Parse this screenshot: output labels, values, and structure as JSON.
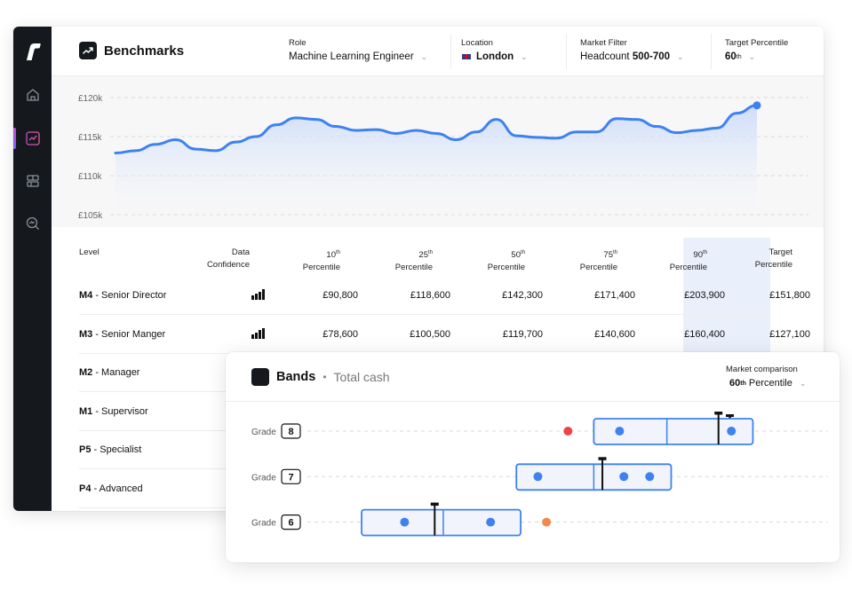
{
  "sidebar": {
    "logo": "r",
    "items": [
      {
        "icon": "home-icon"
      },
      {
        "icon": "trend-icon",
        "active": true
      },
      {
        "icon": "layout-icon"
      },
      {
        "icon": "search-chart-icon"
      }
    ]
  },
  "header": {
    "title": "Benchmarks",
    "filters": [
      {
        "label": "Role",
        "value": "Machine Learning Engineer"
      },
      {
        "label": "Location",
        "value": "London"
      },
      {
        "label": "Market Filter",
        "prefix": "Headcount",
        "value": "500-700"
      },
      {
        "label": "Target Percentile",
        "value": "60",
        "suffix": "th"
      }
    ]
  },
  "chart_data": {
    "type": "area",
    "yticks": [
      "£120k",
      "£115k",
      "£110k",
      "£105k"
    ],
    "ylim": [
      105,
      120
    ],
    "values": [
      112.9,
      113.2,
      114.0,
      114.6,
      113.4,
      113.2,
      114.3,
      115.0,
      116.5,
      117.4,
      117.2,
      116.3,
      115.8,
      115.9,
      115.4,
      115.8,
      115.4,
      114.6,
      115.6,
      117.2,
      115.1,
      114.9,
      114.8,
      115.6,
      115.6,
      117.3,
      117.2,
      116.3,
      115.5,
      115.8,
      116.1,
      118.0,
      119.0
    ],
    "grid": true,
    "line_color": "#3d82f0"
  },
  "table": {
    "headers": {
      "level": "Level",
      "confidence": [
        "Data",
        "Confidence"
      ],
      "p10": [
        "10",
        "th",
        "Percentile"
      ],
      "p25": [
        "25",
        "th",
        "Percentile"
      ],
      "p50": [
        "50",
        "th",
        "Percentile"
      ],
      "p75": [
        "75",
        "th",
        "Percentile"
      ],
      "p90": [
        "90",
        "th",
        "Percentile"
      ],
      "target": [
        "Target",
        "Percentile"
      ]
    },
    "rows": [
      {
        "code": "M4",
        "name": " - Senior Director",
        "p10": "£90,800",
        "p25": "£118,600",
        "p50": "£142,300",
        "p75": "£171,400",
        "p90": "£203,900",
        "target": "£151,800",
        "confidence": 4
      },
      {
        "code": "M3",
        "name": " - Senior Manger",
        "p10": "£78,600",
        "p25": "£100,500",
        "p50": "£119,700",
        "p75": "£140,600",
        "p90": "£160,400",
        "target": "£127,100",
        "confidence": 4
      },
      {
        "code": "M2",
        "name": " - Manager"
      },
      {
        "code": "M1",
        "name": " - Supervisor"
      },
      {
        "code": "P5",
        "name": " - Specialist"
      },
      {
        "code": "P4",
        "name": " - Advanced"
      }
    ]
  },
  "bands": {
    "title": "Bands",
    "subtitle": "Total cash",
    "comparison_label": "Market comparison",
    "comparison_value": "60",
    "comparison_suffix": "th",
    "comparison_word": " Percentile",
    "grade_label": "Grade",
    "grades": [
      {
        "grade": "8",
        "band_start": 0.54,
        "band_end": 0.91,
        "midpoint": 0.71,
        "marker": 0.83,
        "dots": [
          0.6,
          0.86
        ],
        "outlier": 0.48,
        "outlier_color": "#ef4444"
      },
      {
        "grade": "7",
        "band_start": 0.36,
        "band_end": 0.72,
        "midpoint": 0.54,
        "marker": 0.56,
        "dots": [
          0.41,
          0.61,
          0.67
        ],
        "outlier": null
      },
      {
        "grade": "6",
        "band_start": 0.0,
        "band_end": 0.37,
        "midpoint": 0.19,
        "marker": 0.17,
        "dots": [
          0.1,
          0.3
        ],
        "outlier": 0.43,
        "outlier_color": "#f4874b"
      }
    ],
    "band_color": "#3d82f0"
  }
}
